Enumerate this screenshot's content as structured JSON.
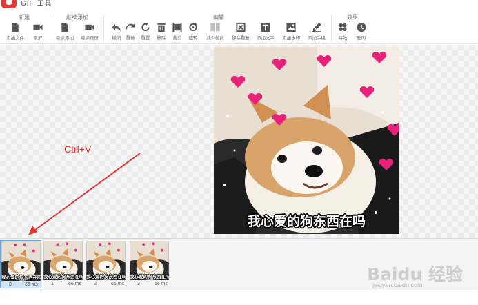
{
  "app": {
    "title": "GIF 工具"
  },
  "toolbar": {
    "groups": [
      {
        "label": "新建"
      },
      {
        "label": "继续添加"
      },
      {
        "label": "编辑"
      },
      {
        "label": "效果"
      }
    ],
    "tools": [
      {
        "label": "添加文件",
        "icon": "add-file-icon"
      },
      {
        "label": "录屏",
        "icon": "camera-icon"
      },
      {
        "label": "继续添加",
        "icon": "add-file-icon"
      },
      {
        "label": "继续录屏",
        "icon": "camera-icon"
      },
      {
        "label": "撤消",
        "icon": "undo-icon"
      },
      {
        "label": "重做",
        "icon": "redo-icon"
      },
      {
        "label": "重置",
        "icon": "reset-icon"
      },
      {
        "label": "删除",
        "icon": "trash-icon"
      },
      {
        "label": "裁剪",
        "icon": "crop-icon"
      },
      {
        "label": "旋转",
        "icon": "rotate-icon"
      },
      {
        "label": "减少帧数",
        "icon": "reduce-frames-icon"
      },
      {
        "label": "移除重复",
        "icon": "remove-duplicates-icon"
      },
      {
        "label": "添加文字",
        "icon": "text-icon"
      },
      {
        "label": "添加水印",
        "icon": "watermark-icon"
      },
      {
        "label": "添加手绘",
        "icon": "brush-icon"
      },
      {
        "label": "特效",
        "icon": "effects-icon"
      },
      {
        "label": "延时",
        "icon": "clock-icon"
      }
    ]
  },
  "preview": {
    "caption": "我心爱的狗东西在吗"
  },
  "hint": {
    "text": "Ctrl+V"
  },
  "frames": [
    {
      "index": "0",
      "duration": "66 ms",
      "caption": "我心爱的狗东西在吗",
      "selected": true
    },
    {
      "index": "1",
      "duration": "66 ms",
      "caption": "我心爱的狗东西在吗",
      "selected": false
    },
    {
      "index": "2",
      "duration": "66 ms",
      "caption": "我心爱的狗东西在吗",
      "selected": false
    },
    {
      "index": "3",
      "duration": "66 ms",
      "caption": "我心爱的狗东西在吗",
      "selected": false
    }
  ],
  "watermark": {
    "text": "Baidu 经验",
    "url": "jingyan.baidu.com"
  },
  "colors": {
    "accent_red": "#e53333",
    "selection_blue": "#cfe3f7",
    "logo_red": "#e03a3a"
  }
}
